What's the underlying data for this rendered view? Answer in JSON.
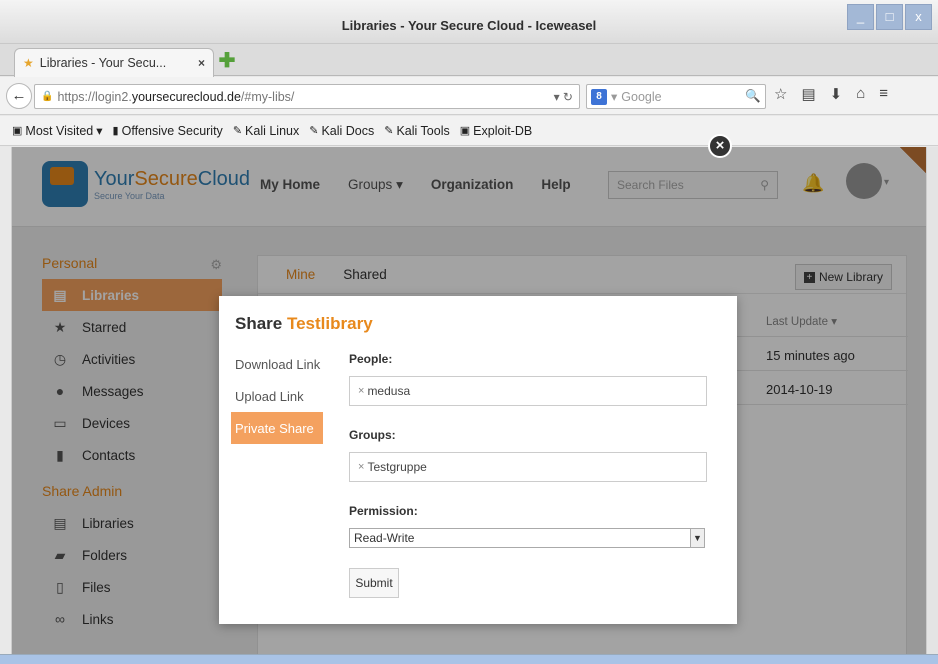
{
  "window": {
    "title": "Libraries - Your Secure Cloud - Iceweasel",
    "buttons": [
      "_",
      "□",
      "x"
    ]
  },
  "tab": {
    "label": "Libraries - Your Secu...",
    "close": "×",
    "new_tab": "✚"
  },
  "navbar": {
    "back": "←",
    "url_prefix": "https://login2.",
    "url_domain": "yoursecurecloud.de",
    "url_suffix": "/#my-libs/",
    "url_controls": "▾ ↻",
    "search_engine": "8",
    "search_placeholder": "Google"
  },
  "bookmarks": [
    "Most Visited",
    "Offensive Security",
    "Kali Linux",
    "Kali Docs",
    "Kali Tools",
    "Exploit-DB"
  ],
  "site": {
    "brand_your": "Your",
    "brand_secure": "Secure",
    "brand_cloud": "Cloud",
    "tagline": "Secure Your Data",
    "nav": [
      "My Home",
      "Groups",
      "Organization",
      "Help"
    ],
    "nav_caret": "▾",
    "search_placeholder": "Search Files"
  },
  "sidebar": {
    "personal": "Personal",
    "personal_items": [
      {
        "label": "Libraries",
        "icon": "library-icon"
      },
      {
        "label": "Starred",
        "icon": "star-icon"
      },
      {
        "label": "Activities",
        "icon": "clock-icon"
      },
      {
        "label": "Messages",
        "icon": "chat-icon"
      },
      {
        "label": "Devices",
        "icon": "monitor-icon"
      },
      {
        "label": "Contacts",
        "icon": "contacts-icon"
      }
    ],
    "share_admin": "Share Admin",
    "admin_items": [
      {
        "label": "Libraries",
        "icon": "library-icon"
      },
      {
        "label": "Folders",
        "icon": "folder-icon"
      },
      {
        "label": "Files",
        "icon": "file-icon"
      },
      {
        "label": "Links",
        "icon": "link-icon"
      }
    ]
  },
  "content": {
    "tabs": [
      "Mine",
      "Shared"
    ],
    "new_library": "New Library",
    "column": "Last Update ▾",
    "rows": [
      "15 minutes ago",
      "2014-10-19"
    ]
  },
  "modal": {
    "title": "Share",
    "library": "Testlibrary",
    "nav": [
      "Download Link",
      "Upload Link",
      "Private Share"
    ],
    "people_label": "People:",
    "people": [
      "medusa"
    ],
    "groups_label": "Groups:",
    "groups": [
      "Testgruppe"
    ],
    "permission_label": "Permission:",
    "permission": "Read-Write",
    "submit": "Submit",
    "close": "×",
    "chip_x": "×"
  }
}
